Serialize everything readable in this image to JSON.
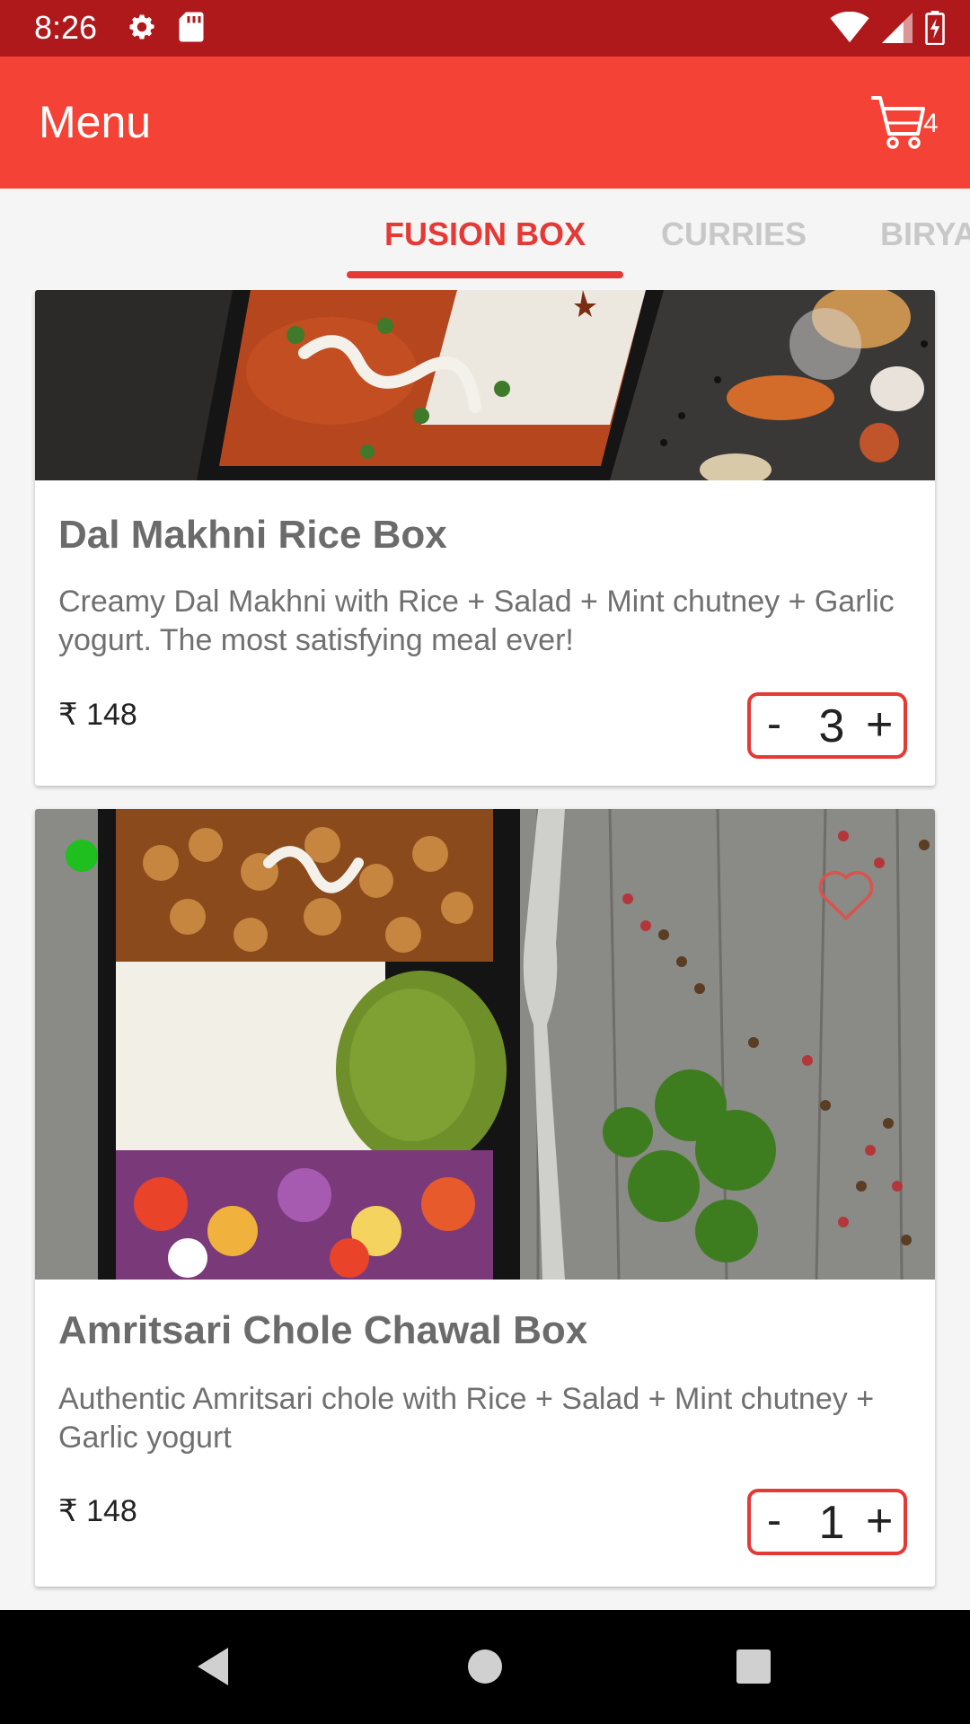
{
  "status_bar": {
    "time": "8:26",
    "left_icons": [
      "gear-icon",
      "sd-card-icon"
    ],
    "right_icons": [
      "wifi-icon",
      "signal-icon",
      "battery-icon"
    ]
  },
  "app_bar": {
    "title": "Menu",
    "cart_count": "4",
    "cart_icon": "cart-icon"
  },
  "tabs": [
    {
      "label": "FUSION BOX",
      "active": true
    },
    {
      "label": "CURRIES",
      "active": false
    },
    {
      "label": "BIRYA",
      "active": false
    }
  ],
  "items": [
    {
      "name": "Dal Makhni Rice Box",
      "description": "Creamy Dal Makhni with Rice + Salad + Mint chutney + Garlic yogurt. The most satisfying meal ever!",
      "price": "₹ 148",
      "quantity": "3"
    },
    {
      "name": "Amritsari Chole Chawal Box",
      "description": "Authentic Amritsari chole with Rice + Salad + Mint chutney + Garlic yogurt",
      "price": "₹ 148",
      "quantity": "1",
      "veg_indicator": "veg-dot-icon",
      "favorite_icon": "heart-outline-icon"
    }
  ],
  "stepper": {
    "minus": "-",
    "plus": "+"
  },
  "nav_bar": [
    "back-icon",
    "home-icon",
    "recents-icon"
  ],
  "colors": {
    "status_bar": "#b0191c",
    "app_bar": "#f44336",
    "accent": "#e53935",
    "veg": "#1fbf1f"
  }
}
